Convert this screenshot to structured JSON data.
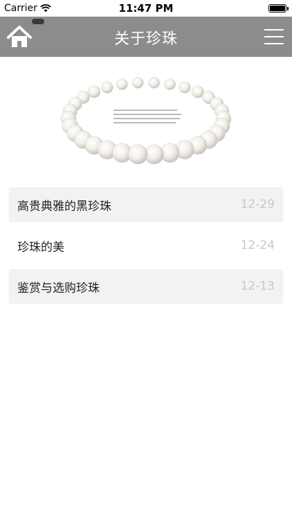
{
  "status_bar": {
    "carrier": "Carrier",
    "time": "11:47 PM"
  },
  "navbar": {
    "title": "关于珍珠",
    "home_icon": "home-icon",
    "menu_icon": "hamburger-menu-icon",
    "bg_color": "#8c8c8c"
  },
  "banner": {
    "subject": "pearl necklace"
  },
  "articles": [
    {
      "title": "高贵典雅的黑珍珠",
      "date": "12-29"
    },
    {
      "title": "珍珠的美",
      "date": "12-24"
    },
    {
      "title": "鉴赏与选购珍珠",
      "date": "12-13"
    }
  ]
}
